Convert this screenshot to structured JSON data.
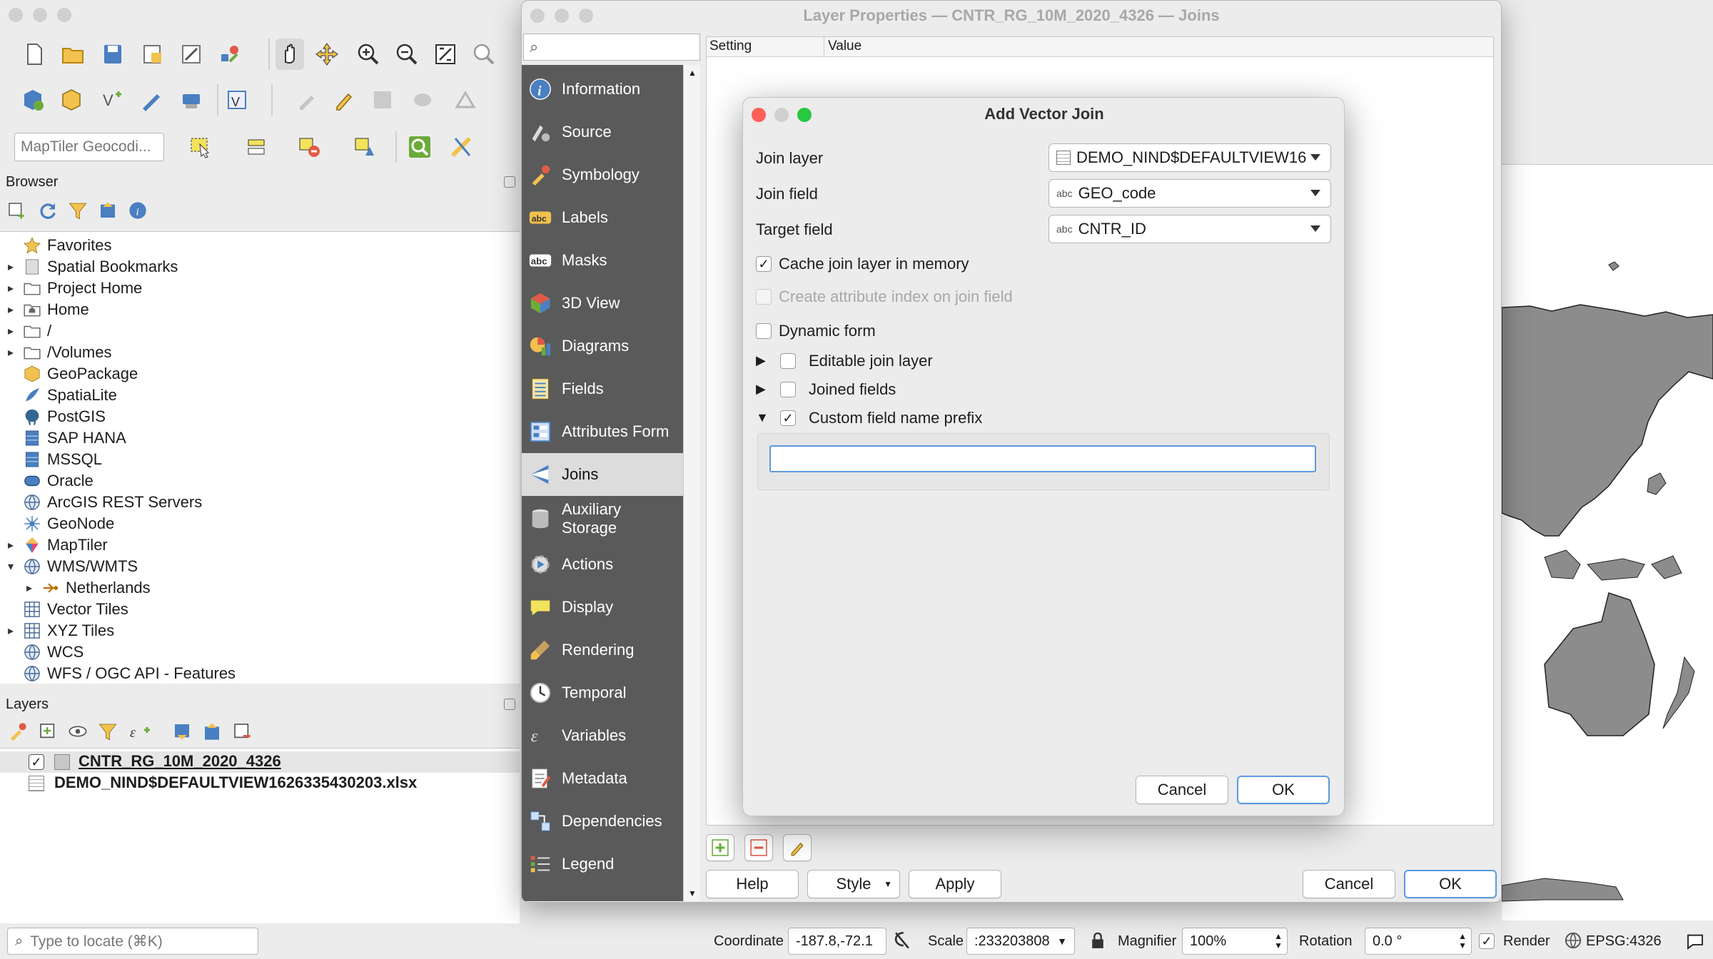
{
  "qgis": {
    "locator_placeholder": "MapTiler Geocodi...",
    "browser_title": "Browser",
    "browser_items": [
      {
        "label": "Favorites",
        "icon": "star-icon",
        "arrow": ""
      },
      {
        "label": "Spatial Bookmarks",
        "icon": "bookmark-icon",
        "arrow": "▸"
      },
      {
        "label": "Project Home",
        "icon": "folder-icon",
        "arrow": "▸"
      },
      {
        "label": "Home",
        "icon": "home-folder-icon",
        "arrow": "▸"
      },
      {
        "label": "/",
        "icon": "folder-icon",
        "arrow": "▸"
      },
      {
        "label": "/Volumes",
        "icon": "folder-icon",
        "arrow": "▸"
      },
      {
        "label": "GeoPackage",
        "icon": "geopackage-icon",
        "arrow": ""
      },
      {
        "label": "SpatiaLite",
        "icon": "spatialite-icon",
        "arrow": ""
      },
      {
        "label": "PostGIS",
        "icon": "postgis-icon",
        "arrow": ""
      },
      {
        "label": "SAP HANA",
        "icon": "database-icon",
        "arrow": ""
      },
      {
        "label": "MSSQL",
        "icon": "database-icon",
        "arrow": ""
      },
      {
        "label": "Oracle",
        "icon": "oracle-icon",
        "arrow": ""
      },
      {
        "label": "ArcGIS REST Servers",
        "icon": "globe-icon",
        "arrow": ""
      },
      {
        "label": "GeoNode",
        "icon": "geonode-icon",
        "arrow": ""
      },
      {
        "label": "MapTiler",
        "icon": "maptiler-icon",
        "arrow": "▸"
      },
      {
        "label": "WMS/WMTS",
        "icon": "globe-icon",
        "arrow": "▾"
      },
      {
        "label": "Netherlands",
        "icon": "connection-icon",
        "arrow": "▸",
        "indent": true
      },
      {
        "label": "Vector Tiles",
        "icon": "grid-icon",
        "arrow": ""
      },
      {
        "label": "XYZ Tiles",
        "icon": "grid-icon",
        "arrow": "▸"
      },
      {
        "label": "WCS",
        "icon": "globe-icon",
        "arrow": ""
      },
      {
        "label": "WFS / OGC API - Features",
        "icon": "globe-icon",
        "arrow": ""
      }
    ],
    "layers_title": "Layers",
    "layers": [
      {
        "label": "CNTR_RG_10M_2020_4326",
        "checked": true,
        "bold": true
      },
      {
        "label": "DEMO_NIND$DEFAULTVIEW1626335430203.xlsx",
        "checked": false,
        "bold": false
      }
    ],
    "locate_placeholder": "Type to locate (⌘K)",
    "status": {
      "coordinate_label": "Coordinate",
      "coordinate_value": "-187.8,-72.1",
      "scale_label": "Scale",
      "scale_value": ":233203808",
      "magnifier_label": "Magnifier",
      "magnifier_value": "100%",
      "rotation_label": "Rotation",
      "rotation_value": "0.0 °",
      "render_label": "Render",
      "crs_label": "EPSG:4326"
    }
  },
  "layer_props": {
    "title": "Layer Properties — CNTR_RG_10M_2020_4326 — Joins",
    "search_placeholder": "",
    "table_headers": [
      "Setting",
      "Value"
    ],
    "sidebar": [
      {
        "label": "Information",
        "icon": "information-icon"
      },
      {
        "label": "Source",
        "icon": "source-icon"
      },
      {
        "label": "Symbology",
        "icon": "symbology-icon"
      },
      {
        "label": "Labels",
        "icon": "labels-icon"
      },
      {
        "label": "Masks",
        "icon": "masks-icon"
      },
      {
        "label": "3D View",
        "icon": "cube-icon"
      },
      {
        "label": "Diagrams",
        "icon": "diagrams-icon"
      },
      {
        "label": "Fields",
        "icon": "fields-icon"
      },
      {
        "label": "Attributes Form",
        "icon": "form-icon"
      },
      {
        "label": "Joins",
        "icon": "joins-icon",
        "selected": true
      },
      {
        "label": "Auxiliary Storage",
        "icon": "auxiliary-storage-icon"
      },
      {
        "label": "Actions",
        "icon": "actions-icon"
      },
      {
        "label": "Display",
        "icon": "display-icon"
      },
      {
        "label": "Rendering",
        "icon": "rendering-icon"
      },
      {
        "label": "Temporal",
        "icon": "clock-icon"
      },
      {
        "label": "Variables",
        "icon": "variables-icon"
      },
      {
        "label": "Metadata",
        "icon": "metadata-icon"
      },
      {
        "label": "Dependencies",
        "icon": "dependencies-icon"
      },
      {
        "label": "Legend",
        "icon": "legend-icon"
      }
    ],
    "help_label": "Help",
    "style_label": "Style",
    "apply_label": "Apply",
    "cancel_label": "Cancel",
    "ok_label": "OK"
  },
  "add_vector_join": {
    "title": "Add Vector Join",
    "join_layer_label": "Join layer",
    "join_layer_value": "DEMO_NIND$DEFAULTVIEW16",
    "join_field_label": "Join field",
    "join_field_value": "GEO_code",
    "target_field_label": "Target field",
    "target_field_value": "CNTR_ID",
    "field_type_badge": "abc",
    "cache_label": "Cache join layer in memory",
    "cache_checked": true,
    "index_label": "Create attribute index on join field",
    "dynamic_label": "Dynamic form",
    "editable_label": "Editable join layer",
    "joined_fields_label": "Joined fields",
    "prefix_label": "Custom field name prefix",
    "prefix_checked": true,
    "prefix_value": "",
    "cancel_label": "Cancel",
    "ok_label": "OK"
  },
  "colors": {
    "sidebar_bg": "#5a5a5a",
    "accent": "#5b9be0",
    "map_land": "#8c8c8c",
    "traffic_red": "#fe5f57",
    "traffic_yellow": "#febc2e",
    "traffic_green": "#28c840"
  }
}
